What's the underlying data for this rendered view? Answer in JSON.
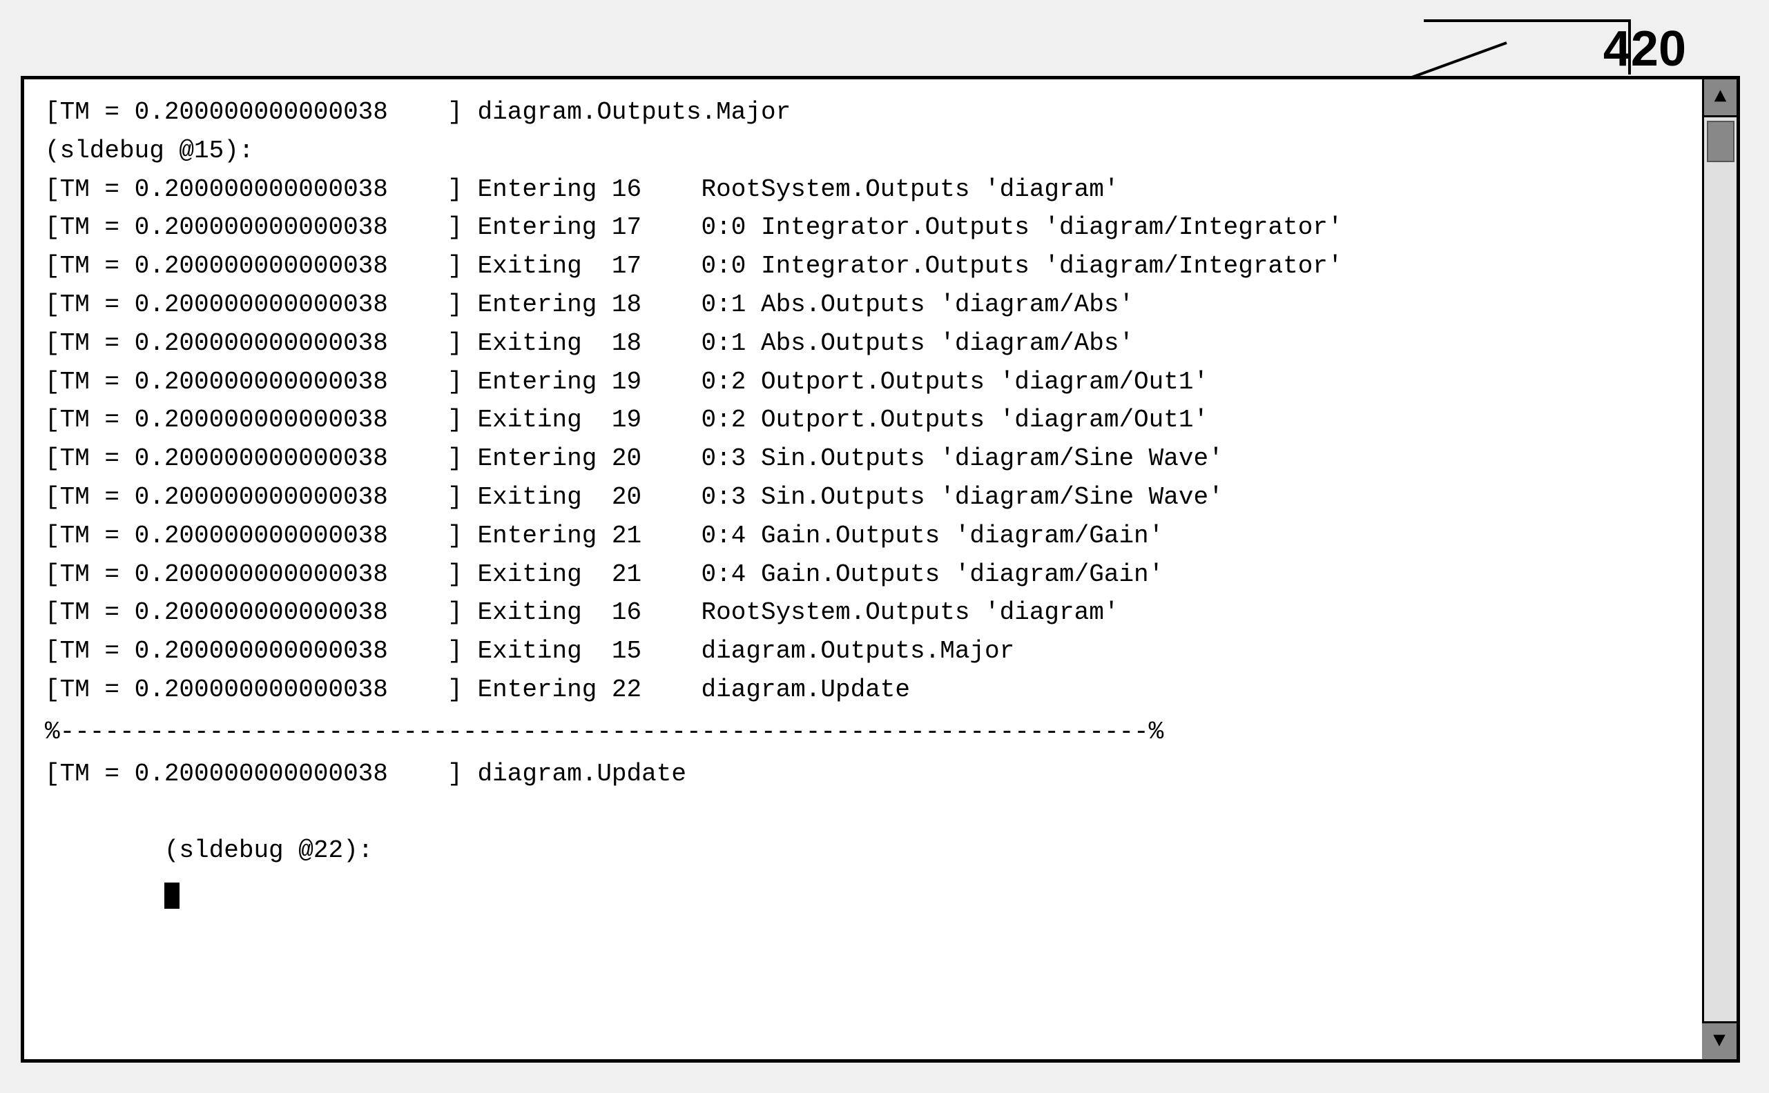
{
  "page": {
    "number": "420",
    "background": "#f0f0f0"
  },
  "terminal": {
    "lines": [
      {
        "id": "line1",
        "text": "[TM = 0.200000000000038    ] diagram.Outputs.Major"
      },
      {
        "id": "line2",
        "text": "(sldebug @15):"
      },
      {
        "id": "line3",
        "text": "[TM = 0.200000000000038    ] Entering 16    RootSystem.Outputs 'diagram'"
      },
      {
        "id": "line4",
        "text": "[TM = 0.200000000000038    ] Entering 17    0:0 Integrator.Outputs 'diagram/Integrator'"
      },
      {
        "id": "line5",
        "text": "[TM = 0.200000000000038    ] Exiting  17    0:0 Integrator.Outputs 'diagram/Integrator'"
      },
      {
        "id": "line6",
        "text": "[TM = 0.200000000000038    ] Entering 18    0:1 Abs.Outputs 'diagram/Abs'"
      },
      {
        "id": "line7",
        "text": "[TM = 0.200000000000038    ] Exiting  18    0:1 Abs.Outputs 'diagram/Abs'"
      },
      {
        "id": "line8",
        "text": "[TM = 0.200000000000038    ] Entering 19    0:2 Outport.Outputs 'diagram/Out1'"
      },
      {
        "id": "line9",
        "text": "[TM = 0.200000000000038    ] Exiting  19    0:2 Outport.Outputs 'diagram/Out1'"
      },
      {
        "id": "line10",
        "text": "[TM = 0.200000000000038    ] Entering 20    0:3 Sin.Outputs 'diagram/Sine Wave'"
      },
      {
        "id": "line11",
        "text": "[TM = 0.200000000000038    ] Exiting  20    0:3 Sin.Outputs 'diagram/Sine Wave'"
      },
      {
        "id": "line12",
        "text": "[TM = 0.200000000000038    ] Entering 21    0:4 Gain.Outputs 'diagram/Gain'"
      },
      {
        "id": "line13",
        "text": "[TM = 0.200000000000038    ] Exiting  21    0:4 Gain.Outputs 'diagram/Gain'"
      },
      {
        "id": "line14",
        "text": "[TM = 0.200000000000038    ] Exiting  16    RootSystem.Outputs 'diagram'"
      },
      {
        "id": "line15",
        "text": "[TM = 0.200000000000038    ] Exiting  15    diagram.Outputs.Major"
      },
      {
        "id": "line16",
        "text": "[TM = 0.200000000000038    ] Entering 22    diagram.Update"
      }
    ],
    "separator": "%-------------------------------------------------------------------------%",
    "bottom_lines": [
      {
        "id": "bline1",
        "text": "[TM = 0.200000000000038    ] diagram.Update"
      },
      {
        "id": "bline2",
        "text": "(sldebug @22):"
      }
    ],
    "scrollbar": {
      "up_arrow": "▲",
      "down_arrow": "▼"
    }
  }
}
